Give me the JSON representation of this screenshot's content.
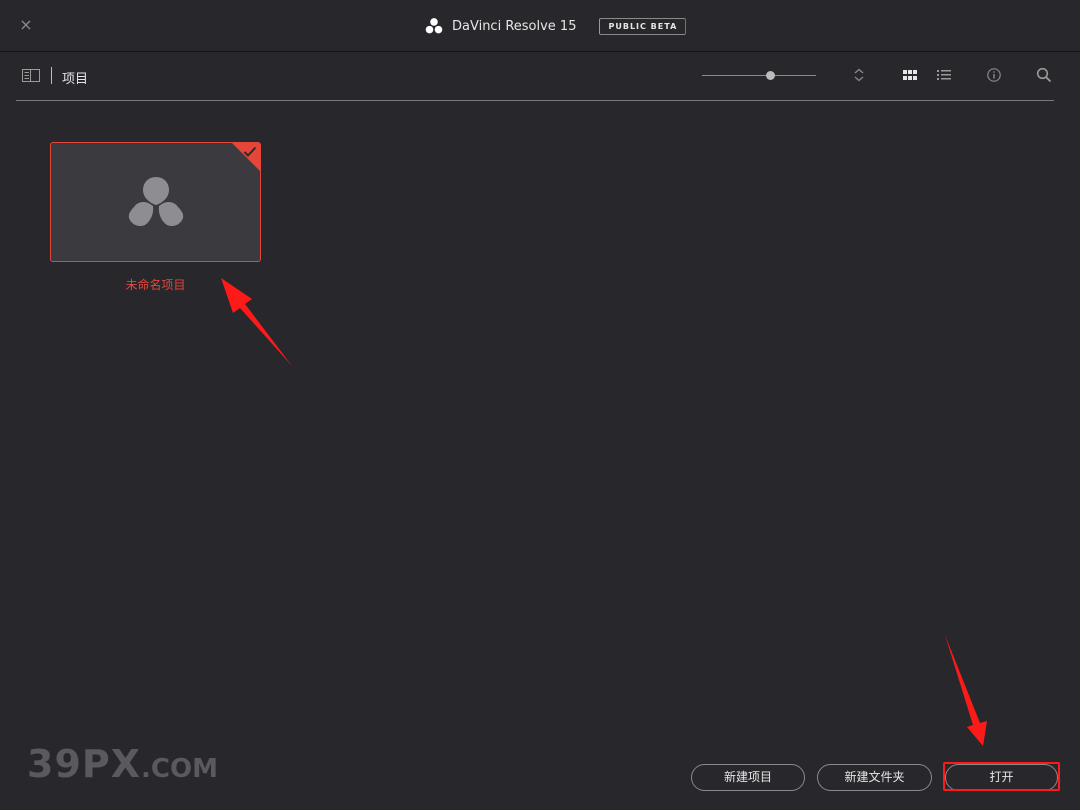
{
  "window": {
    "close_label": "×",
    "title": "DaVinci Resolve 15",
    "badge": "PUBLIC BETA",
    "logo_icon": "davinci-logo-icon"
  },
  "toolbar": {
    "section_title": "项目",
    "sidebar_toggle_icon": "sidebar-toggle-icon",
    "zoom_slider_level": 0.6,
    "icons": [
      "sort-icon",
      "grid-view-icon",
      "list-view-icon",
      "info-icon",
      "search-icon"
    ]
  },
  "projects": [
    {
      "name": "未命名项目",
      "selected": true
    }
  ],
  "footer": {
    "new_project_label": "新建项目",
    "new_folder_label": "新建文件夹",
    "open_label": "打开"
  },
  "watermark": {
    "main": "39PX",
    "suffix": ".COM"
  },
  "colors": {
    "background": "#28272c",
    "accent_red": "#e4463a",
    "annotation_red": "#ff1a1a",
    "card": "#3a3a3f"
  }
}
